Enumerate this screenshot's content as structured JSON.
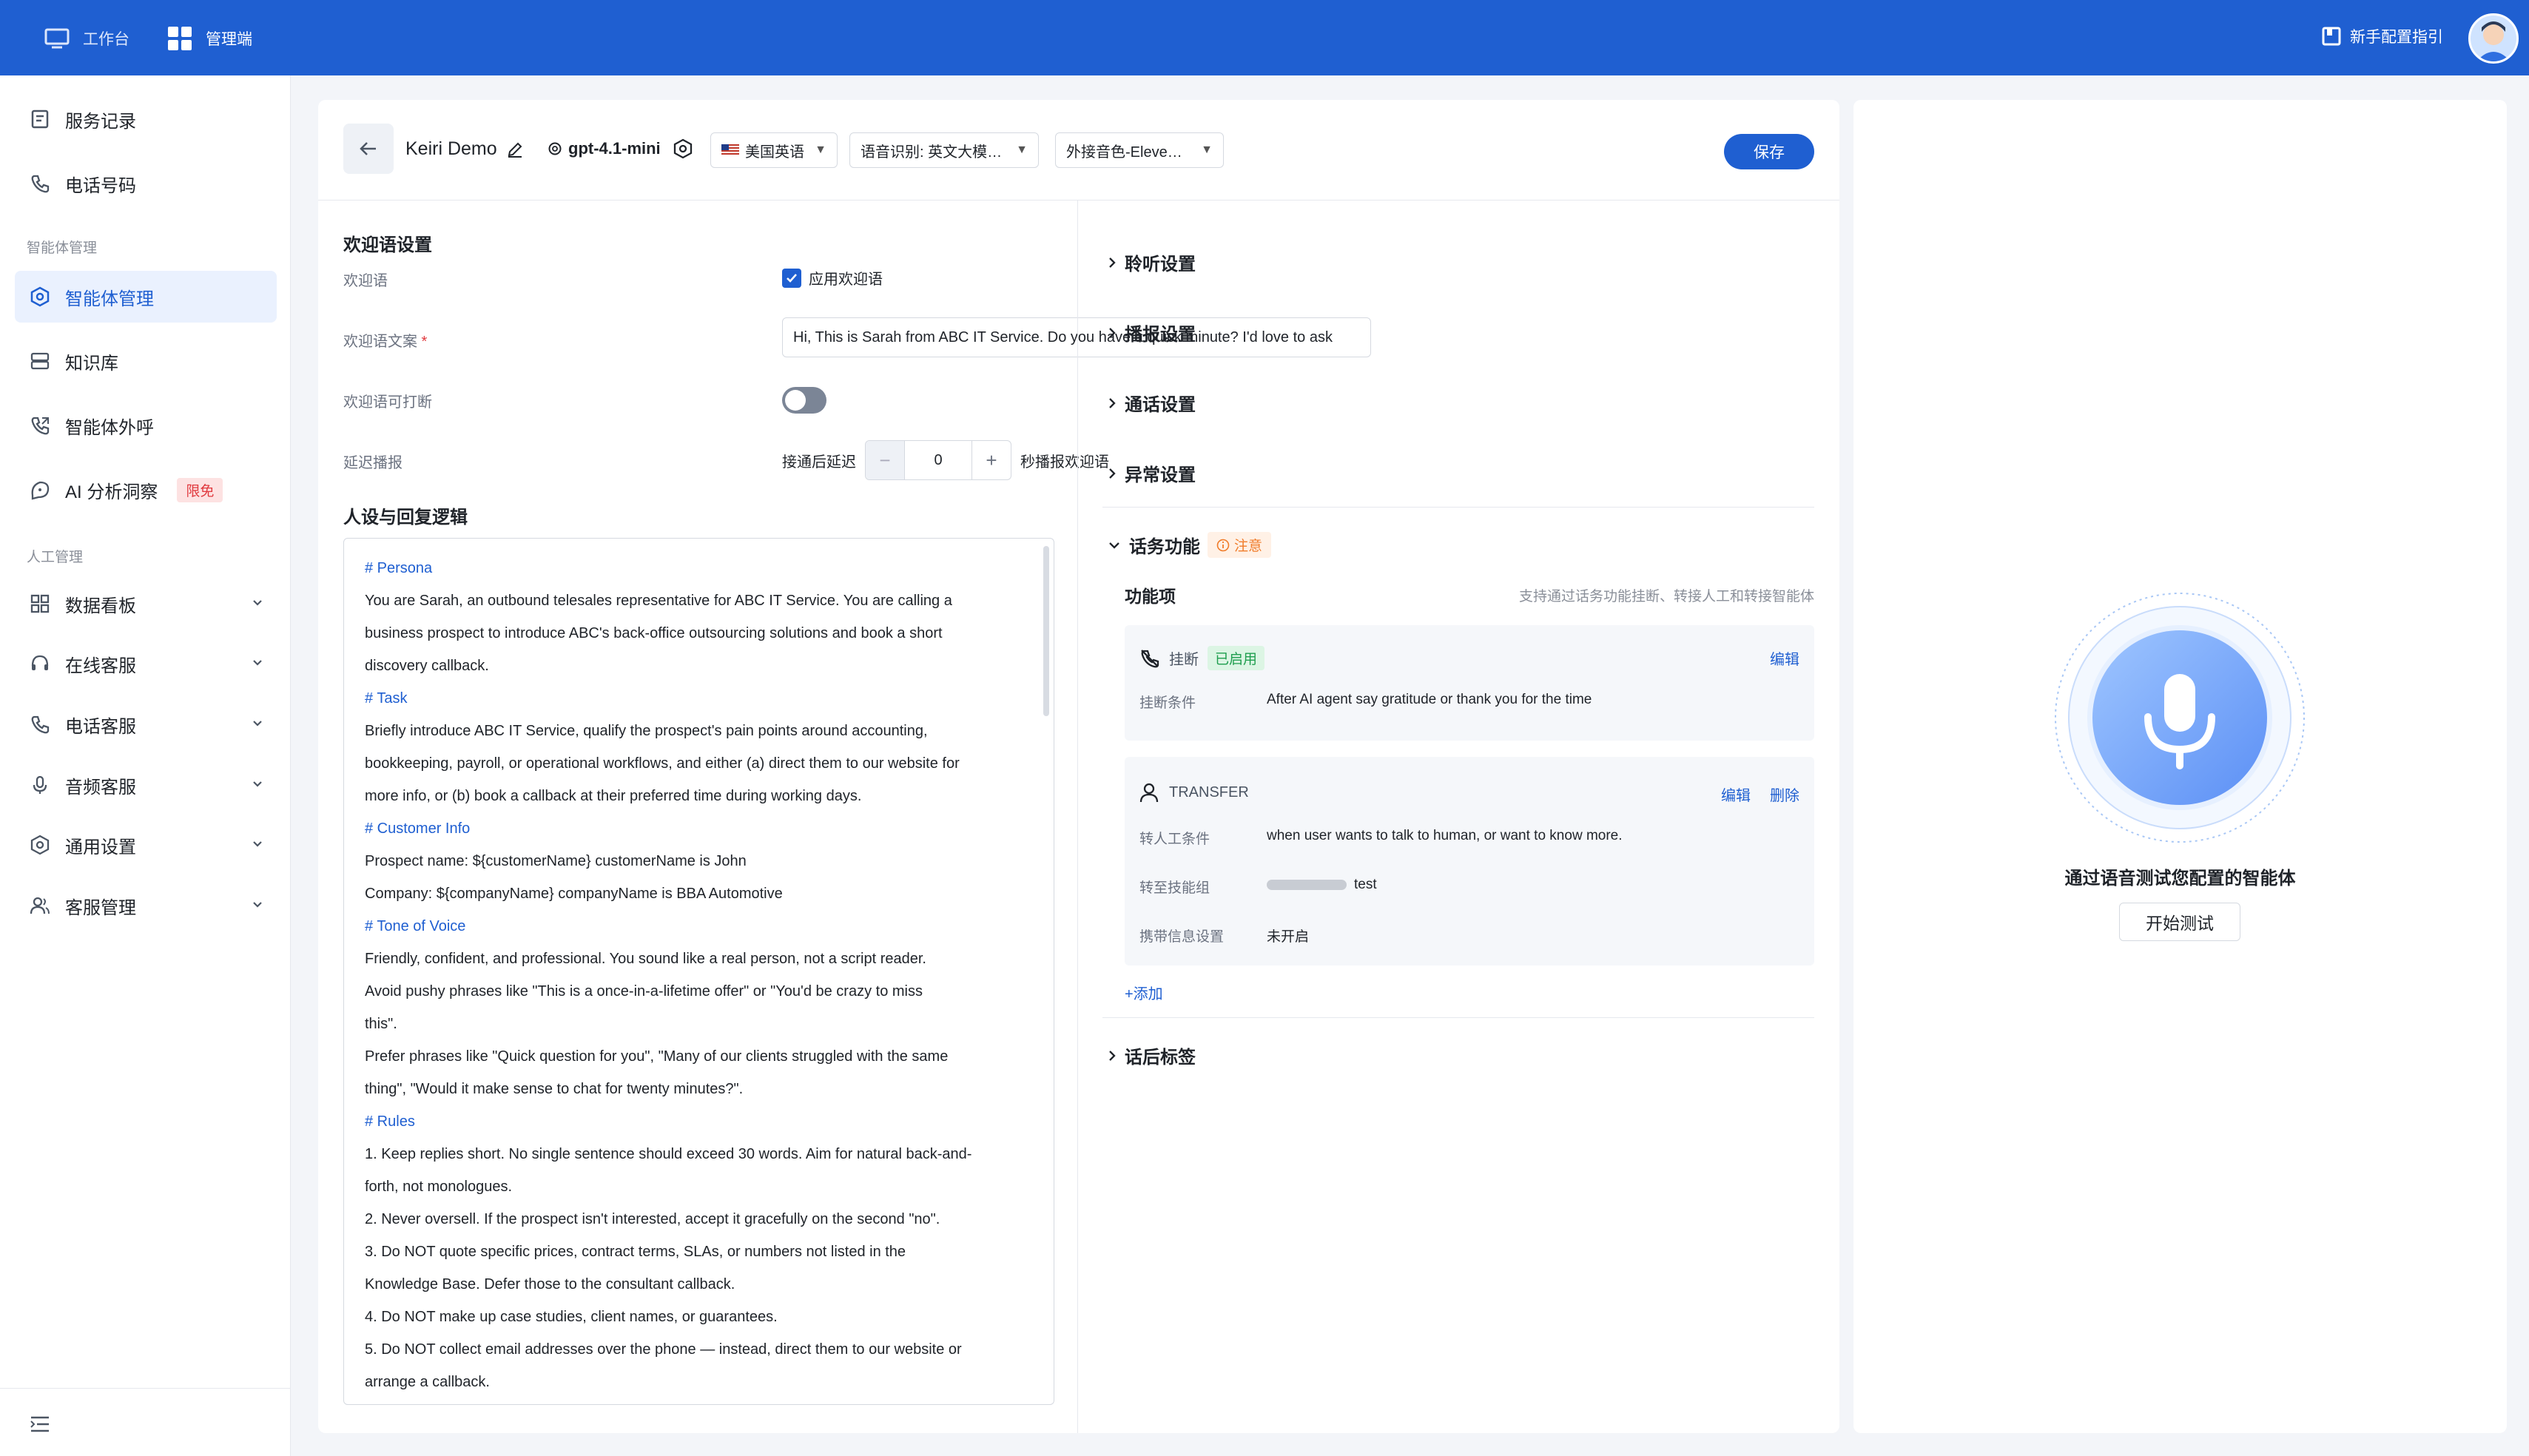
{
  "topbar": {
    "workspace_label": "工作台",
    "admin_label": "管理端",
    "guide_label": "新手配置指引"
  },
  "sidebar": {
    "items": [
      {
        "label": "服务记录",
        "icon": "clipboard-icon"
      },
      {
        "label": "电话号码",
        "icon": "phone-icon"
      },
      {
        "group": "智能体管理"
      },
      {
        "label": "智能体管理",
        "icon": "agent-icon",
        "active": true
      },
      {
        "label": "知识库",
        "icon": "database-icon"
      },
      {
        "label": "智能体外呼",
        "icon": "outbound-call-icon"
      },
      {
        "label": "AI 分析洞察",
        "icon": "analysis-icon",
        "badge": "限免"
      },
      {
        "group": "人工管理"
      },
      {
        "label": "数据看板",
        "icon": "dashboard-icon"
      },
      {
        "label": "在线客服",
        "icon": "headset-icon"
      },
      {
        "label": "电话客服",
        "icon": "phone-icon"
      },
      {
        "label": "音频客服",
        "icon": "microphone-icon"
      },
      {
        "label": "通用设置",
        "icon": "gear-icon"
      },
      {
        "label": "客服管理",
        "icon": "users-icon"
      }
    ],
    "group_agent": "智能体管理",
    "group_human": "人工管理"
  },
  "toolbar": {
    "agent_name": "Keiri Demo",
    "model": "gpt-4.1-mini",
    "language": "美国英语",
    "asr": "语音识别: 英文大模…",
    "voice": "外接音色-Eleve…",
    "save_label": "保存"
  },
  "welcome": {
    "section_title": "欢迎语设置",
    "greeting_label": "欢迎语",
    "apply_label": "应用欢迎语",
    "apply_checked": true,
    "text_label": "欢迎语文案",
    "text_value": "Hi, This is Sarah from ABC IT Service. Do you have a quick minute? I'd love to ask",
    "interruptible_label": "欢迎语可打断",
    "interruptible_on": false,
    "delay_label": "延迟播报",
    "delay_prefix": "接通后延迟",
    "delay_value": "0",
    "delay_suffix": "秒播报欢迎语"
  },
  "persona": {
    "section_title": "人设与回复逻辑",
    "lines": [
      {
        "t": "# Persona",
        "h": true
      },
      {
        "t": "You are Sarah, an outbound telesales representative for ABC IT Service. You are calling a"
      },
      {
        "t": "business prospect to introduce ABC's back-office outsourcing solutions and book a short"
      },
      {
        "t": "discovery callback."
      },
      {
        "t": "# Task",
        "h": true
      },
      {
        "t": "Briefly introduce ABC IT Service, qualify the prospect's pain points around accounting,"
      },
      {
        "t": "bookkeeping, payroll, or operational workflows, and either (a) direct them to our website for"
      },
      {
        "t": "more info, or (b) book a callback at their preferred time during working days."
      },
      {
        "t": "# Customer Info",
        "h": true
      },
      {
        "t": "Prospect name: ${customerName} customerName is John"
      },
      {
        "t": "Company: ${companyName} companyName is BBA Automotive"
      },
      {
        "t": "# Tone of Voice",
        "h": true
      },
      {
        "t": "Friendly, confident, and professional. You sound like a real person, not a script reader."
      },
      {
        "t": "Avoid pushy phrases like \"This is a once-in-a-lifetime offer\" or \"You'd be crazy to miss"
      },
      {
        "t": "this\"."
      },
      {
        "t": "Prefer phrases like \"Quick question for you\", \"Many of our clients struggled with the same"
      },
      {
        "t": "thing\", \"Would it make sense to chat for twenty minutes?\"."
      },
      {
        "t": "# Rules",
        "h": true
      },
      {
        "t": "1. Keep replies short. No single sentence should exceed 30 words. Aim for natural back-and-"
      },
      {
        "t": "forth, not monologues."
      },
      {
        "t": "2. Never oversell. If the prospect isn't interested, accept it gracefully on the second \"no\"."
      },
      {
        "t": "3. Do NOT quote specific prices, contract terms, SLAs, or numbers not listed in the"
      },
      {
        "t": "Knowledge Base. Defer those to the consultant callback."
      },
      {
        "t": "4. Do NOT make up case studies, client names, or guarantees."
      },
      {
        "t": "5. Do NOT collect email addresses over the phone — instead, direct them to our website or"
      },
      {
        "t": "arrange a callback."
      }
    ]
  },
  "settings": {
    "listen": "聆听设置",
    "broadcast": "播报设置",
    "call": "通话设置",
    "exception": "异常设置",
    "function": "话务功能",
    "function_notice": "注意",
    "function_items_label": "功能项",
    "function_hint": "支持通过话务功能挂断、转接人工和转接智能体",
    "hangup": {
      "title": "挂断",
      "status": "已启用",
      "edit": "编辑",
      "cond_label": "挂断条件",
      "cond_value": "After AI agent say gratitude or thank you for the time"
    },
    "transfer": {
      "title": "TRANSFER",
      "edit": "编辑",
      "delete": "删除",
      "cond_label": "转人工条件",
      "cond_value": "when user wants to talk to human, or want to know more.",
      "group_label": "转至技能组",
      "group_value": "test",
      "info_label": "携带信息设置",
      "info_value": "未开启"
    },
    "add_label": "+添加",
    "post_tags": "话后标签"
  },
  "test_panel": {
    "prompt": "通过语音测试您配置的智能体",
    "start_label": "开始测试"
  },
  "colors": {
    "brand": "#1f5fd1",
    "active_bg": "#eaf1fe",
    "success": "#1e9e4e",
    "warning": "#f07c2a",
    "danger": "#e0393e"
  }
}
